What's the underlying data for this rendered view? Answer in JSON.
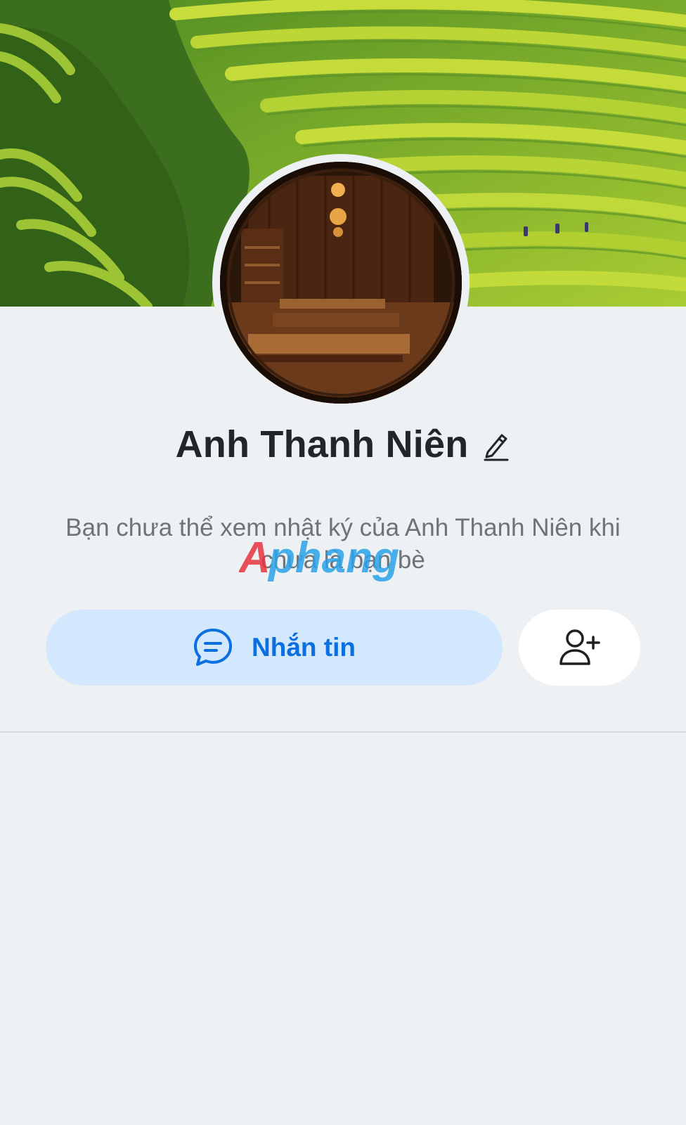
{
  "profile": {
    "name": "Anh Thanh Niên",
    "notice": "Bạn chưa thể xem nhật ký của Anh Thanh Niên khi chưa là bạn bè"
  },
  "actions": {
    "message_label": "Nhắn tin",
    "message_icon": "chat-bubble-icon",
    "add_friend_icon": "add-friend-icon"
  },
  "watermark": {
    "text": "Aphang"
  },
  "colors": {
    "accent": "#0b6fe0",
    "message_button_bg": "#d4e8fd",
    "page_bg": "#eef1f4",
    "name_text": "#222629",
    "muted_text": "#6e7378"
  }
}
